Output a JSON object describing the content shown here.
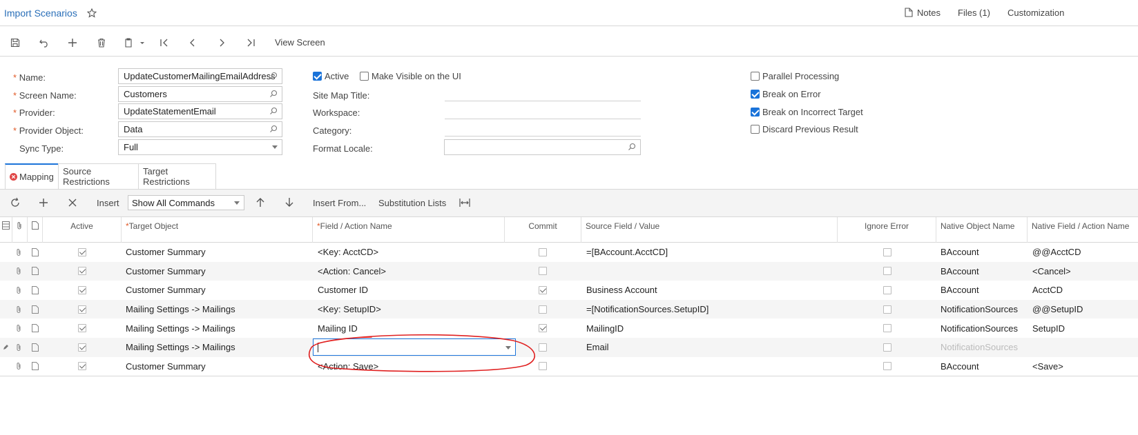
{
  "header": {
    "title": "Import Scenarios",
    "notes": "Notes",
    "files": "Files (1)",
    "customization": "Customization"
  },
  "toolbar": {
    "view_screen": "View Screen"
  },
  "form": {
    "name_label": "Name:",
    "name_value": "UpdateCustomerMailingEmailAddress",
    "screen_label": "Screen Name:",
    "screen_value": "Customers",
    "provider_label": "Provider:",
    "provider_value": "UpdateStatementEmail",
    "provider_object_label": "Provider Object:",
    "provider_object_value": "Data",
    "sync_label": "Sync Type:",
    "sync_value": "Full",
    "active_label": "Active",
    "active_checked": true,
    "visible_label": "Make Visible on the UI",
    "visible_checked": false,
    "site_map_label": "Site Map Title:",
    "workspace_label": "Workspace:",
    "category_label": "Category:",
    "format_locale_label": "Format Locale:",
    "parallel_label": "Parallel Processing",
    "parallel_checked": false,
    "break_error_label": "Break on Error",
    "break_error_checked": true,
    "break_target_label": "Break on Incorrect Target",
    "break_target_checked": true,
    "discard_label": "Discard Previous Result",
    "discard_checked": false,
    "required_marker": "*"
  },
  "tabs": [
    "Mapping",
    "Source Restrictions",
    "Target Restrictions"
  ],
  "grid_toolbar": {
    "insert": "Insert",
    "filter_value": "Show All Commands",
    "insert_from": "Insert From...",
    "substitution_lists": "Substitution Lists"
  },
  "grid": {
    "columns": {
      "active": "Active",
      "target_object": "Target Object",
      "field_action": "Field / Action Name",
      "commit": "Commit",
      "source_field": "Source Field / Value",
      "ignore_error": "Ignore Error",
      "native_object": "Native Object Name",
      "native_field": "Native Field / Action Name"
    },
    "rows": [
      {
        "target": "Customer Summary",
        "field": "<Key: AcctCD>",
        "commit": false,
        "source": "=[BAccount.AcctCD]",
        "ignore": false,
        "native_object": "BAccount",
        "native_field": "@@AcctCD"
      },
      {
        "target": "Customer Summary",
        "field": "<Action: Cancel>",
        "commit": false,
        "source": "",
        "ignore": false,
        "native_object": "BAccount",
        "native_field": "<Cancel>"
      },
      {
        "target": "Customer Summary",
        "field": "Customer ID",
        "commit": true,
        "source": "Business Account",
        "ignore": false,
        "native_object": "BAccount",
        "native_field": "AcctCD"
      },
      {
        "target": "Mailing Settings -> Mailings",
        "field": "<Key: SetupID>",
        "commit": false,
        "source": "=[NotificationSources.SetupID]",
        "ignore": false,
        "native_object": "NotificationSources",
        "native_field": "@@SetupID"
      },
      {
        "target": "Mailing Settings -> Mailings",
        "field": "Mailing ID",
        "commit": true,
        "source": "MailingID",
        "ignore": false,
        "native_object": "NotificationSources",
        "native_field": "SetupID"
      },
      {
        "target": "Mailing Settings -> Mailings",
        "field": "",
        "commit": false,
        "source": "Email",
        "ignore": false,
        "native_object": "NotificationSources",
        "native_field": ""
      },
      {
        "target": "Customer Summary",
        "field": "<Action: Save>",
        "commit": false,
        "source": "",
        "ignore": false,
        "native_object": "BAccount",
        "native_field": "<Save>"
      }
    ]
  },
  "colors": {
    "accent": "#1a73d9",
    "title": "#2a6fb8",
    "required": "#e15a28",
    "annotation": "#e02020"
  }
}
